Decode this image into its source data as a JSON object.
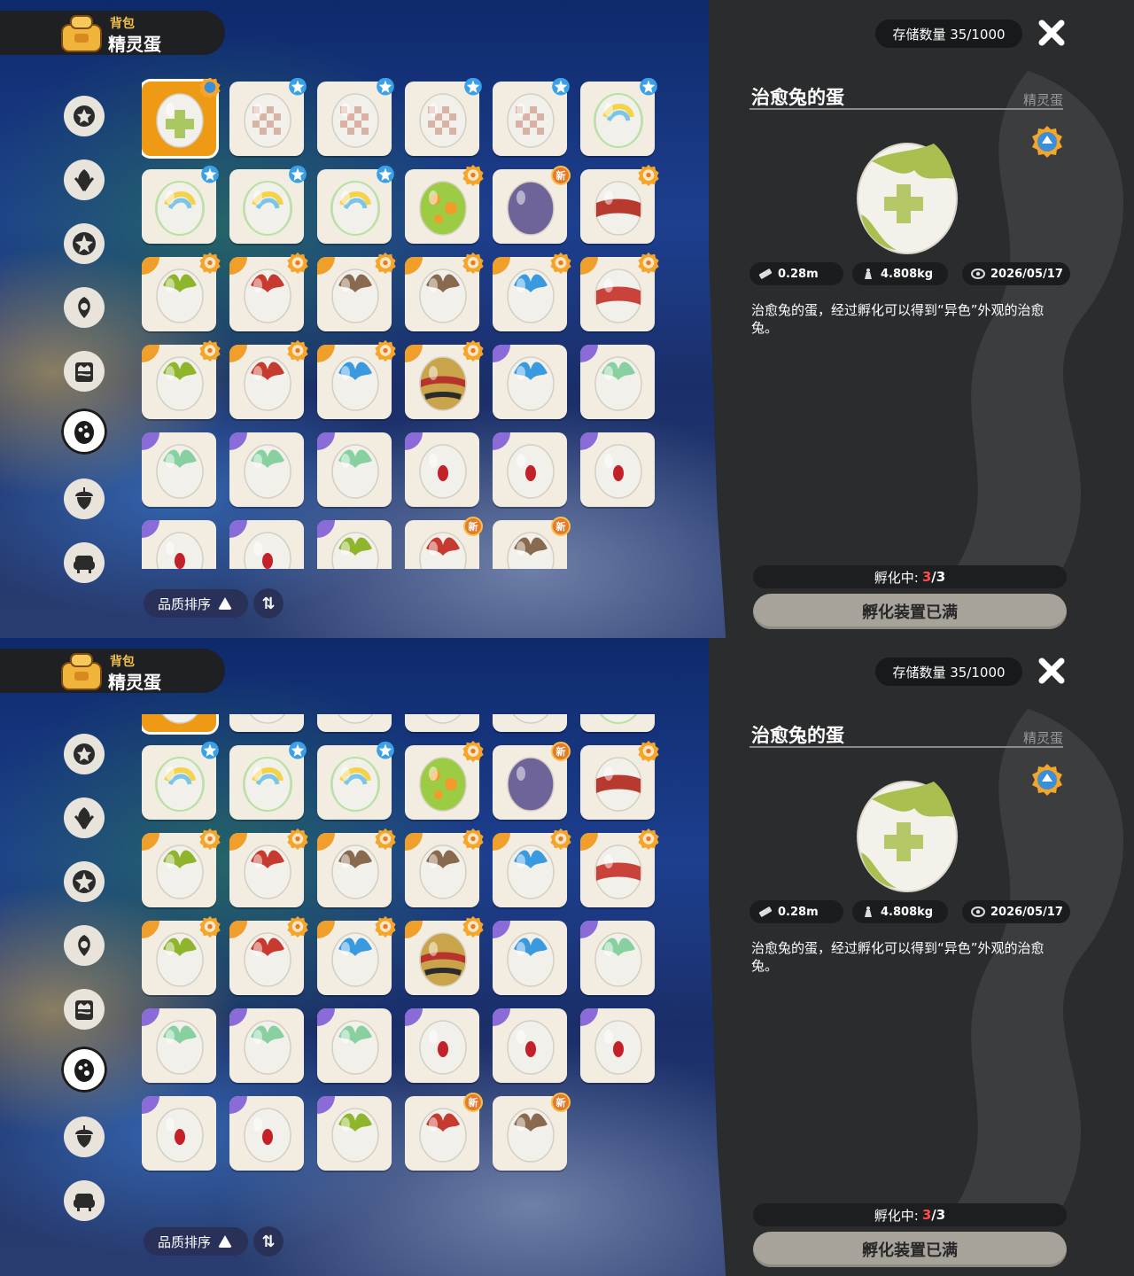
{
  "screens": [
    {
      "id": "top",
      "scroll_offset": 0
    },
    {
      "id": "bottom",
      "scroll_offset": 1
    }
  ],
  "header": {
    "section": "背包",
    "title": "精灵蛋"
  },
  "storage_label": "存储数量 35/1000",
  "categories": [
    {
      "icon": "star-badge-icon",
      "active": false
    },
    {
      "icon": "leaf-icon",
      "active": false
    },
    {
      "icon": "sparkle-star-icon",
      "active": false
    },
    {
      "icon": "flower-icon",
      "active": false
    },
    {
      "icon": "crown-scroll-icon",
      "active": false
    },
    {
      "icon": "egg-icon",
      "active": true
    },
    {
      "icon": "acorn-icon",
      "active": false
    },
    {
      "icon": "armchair-icon",
      "active": false
    }
  ],
  "sort": {
    "label": "品质排序"
  },
  "eggs": [
    {
      "name": "heal-rabbit-egg",
      "pattern": "cross",
      "color": "#9fbf4a",
      "corner": "",
      "badge": "rank",
      "selected": true
    },
    {
      "name": "checker-egg",
      "pattern": "checker",
      "color": "#c98a7a",
      "corner": "",
      "badge": "star",
      "selected": false
    },
    {
      "name": "checker-egg",
      "pattern": "checker",
      "color": "#c98a7a",
      "corner": "",
      "badge": "star",
      "selected": false
    },
    {
      "name": "checker-egg",
      "pattern": "checker",
      "color": "#c98a7a",
      "corner": "",
      "badge": "star",
      "selected": false
    },
    {
      "name": "checker-egg",
      "pattern": "checker",
      "color": "#c98a7a",
      "corner": "",
      "badge": "star",
      "selected": false
    },
    {
      "name": "rainbow-egg",
      "pattern": "rainbow",
      "color": "#7bd38a",
      "corner": "",
      "badge": "star",
      "selected": false
    },
    {
      "name": "rainbow-egg",
      "pattern": "rainbow",
      "color": "#7bd38a",
      "corner": "",
      "badge": "star",
      "selected": false
    },
    {
      "name": "rainbow-egg",
      "pattern": "rainbow",
      "color": "#7bd38a",
      "corner": "",
      "badge": "star",
      "selected": false
    },
    {
      "name": "rainbow-egg",
      "pattern": "rainbow",
      "color": "#7bd38a",
      "corner": "",
      "badge": "star",
      "selected": false
    },
    {
      "name": "green-spot-egg",
      "pattern": "spots",
      "color": "#8cc63f",
      "corner": "",
      "badge": "medal",
      "selected": false
    },
    {
      "name": "purple-egg",
      "pattern": "solid",
      "color": "#6f6499",
      "corner": "",
      "badge": "new",
      "selected": false
    },
    {
      "name": "red-band-egg",
      "pattern": "band",
      "color": "#b83a2f",
      "corner": "",
      "badge": "medal",
      "selected": false
    },
    {
      "name": "leaf-egg",
      "pattern": "leaf",
      "color": "#8fb52c",
      "corner": "#f0a02a",
      "badge": "medal",
      "selected": false
    },
    {
      "name": "red-leaf-egg",
      "pattern": "leaf",
      "color": "#c63a2f",
      "corner": "#f0a02a",
      "badge": "medal",
      "selected": false
    },
    {
      "name": "brown-leaf-egg",
      "pattern": "leaf",
      "color": "#8a6a4f",
      "corner": "#f0a02a",
      "badge": "medal",
      "selected": false
    },
    {
      "name": "brown-leaf-egg",
      "pattern": "leaf",
      "color": "#8a6a4f",
      "corner": "#f0a02a",
      "badge": "medal",
      "selected": false
    },
    {
      "name": "blue-leaf-egg",
      "pattern": "leaf",
      "color": "#3a9ae0",
      "corner": "#f0a02a",
      "badge": "medal",
      "selected": false
    },
    {
      "name": "red-band-egg",
      "pattern": "band",
      "color": "#c9433a",
      "corner": "#f0a02a",
      "badge": "medal",
      "selected": false
    },
    {
      "name": "leaf-egg",
      "pattern": "leaf",
      "color": "#8fb52c",
      "corner": "#f0a02a",
      "badge": "medal",
      "selected": false
    },
    {
      "name": "red-leaf-egg",
      "pattern": "leaf",
      "color": "#c63a2f",
      "corner": "#f0a02a",
      "badge": "medal",
      "selected": false
    },
    {
      "name": "blue-leaf-egg",
      "pattern": "leaf",
      "color": "#3a9ae0",
      "corner": "#f0a02a",
      "badge": "medal",
      "selected": false
    },
    {
      "name": "striped-egg",
      "pattern": "stripes",
      "color": "#9a7a2f",
      "corner": "#f0a02a",
      "badge": "medal",
      "selected": false
    },
    {
      "name": "blue-leaf-egg",
      "pattern": "leaf",
      "color": "#3a9ae0",
      "corner": "#8a6bd8",
      "badge": "",
      "selected": false
    },
    {
      "name": "mint-leaf-egg",
      "pattern": "leaf",
      "color": "#88d0a0",
      "corner": "#8a6bd8",
      "badge": "",
      "selected": false
    },
    {
      "name": "mint-leaf-egg",
      "pattern": "leaf",
      "color": "#88d0a0",
      "corner": "#8a6bd8",
      "badge": "",
      "selected": false
    },
    {
      "name": "mint-leaf-egg",
      "pattern": "leaf",
      "color": "#88d0a0",
      "corner": "#8a6bd8",
      "badge": "",
      "selected": false
    },
    {
      "name": "mint-leaf-egg",
      "pattern": "leaf",
      "color": "#88d0a0",
      "corner": "#8a6bd8",
      "badge": "",
      "selected": false
    },
    {
      "name": "red-dot-egg",
      "pattern": "dot",
      "color": "#c4202a",
      "corner": "#8a6bd8",
      "badge": "",
      "selected": false
    },
    {
      "name": "red-dot-egg",
      "pattern": "dot",
      "color": "#c4202a",
      "corner": "#8a6bd8",
      "badge": "",
      "selected": false
    },
    {
      "name": "red-dot-egg",
      "pattern": "dot",
      "color": "#c4202a",
      "corner": "#8a6bd8",
      "badge": "",
      "selected": false
    },
    {
      "name": "red-dot-egg",
      "pattern": "dot",
      "color": "#c4202a",
      "corner": "#8a6bd8",
      "badge": "",
      "selected": false
    },
    {
      "name": "red-dot-egg",
      "pattern": "dot",
      "color": "#c4202a",
      "corner": "#8a6bd8",
      "badge": "",
      "selected": false
    },
    {
      "name": "leaf-egg",
      "pattern": "leaf",
      "color": "#8fb52c",
      "corner": "#8a6bd8",
      "badge": "",
      "selected": false
    },
    {
      "name": "red-leaf-egg",
      "pattern": "leaf",
      "color": "#c63a2f",
      "corner": "",
      "badge": "new",
      "selected": false
    },
    {
      "name": "brown-leaf-egg",
      "pattern": "leaf",
      "color": "#8a6a4f",
      "corner": "",
      "badge": "new",
      "selected": false
    }
  ],
  "new_label": "新",
  "detail": {
    "title": "治愈兔的蛋",
    "type": "精灵蛋",
    "egg_color": "#a9bf4f",
    "stats": [
      {
        "icon": "ruler-icon",
        "value": "0.28m"
      },
      {
        "icon": "weight-icon",
        "value": "4.808kg"
      },
      {
        "icon": "eye-icon",
        "value": "2026/05/17"
      }
    ],
    "description": "治愈兔的蛋，经过孵化可以得到“异色”外观的治愈兔。",
    "hatch_label": "孵化中:",
    "hatch_current": "3",
    "hatch_total": "/3",
    "hatch_button": "孵化装置已满"
  },
  "colors": {
    "accent": "#ef9a15",
    "panel": "#2a2c2e",
    "hatch_red": "#ff4b4b"
  }
}
